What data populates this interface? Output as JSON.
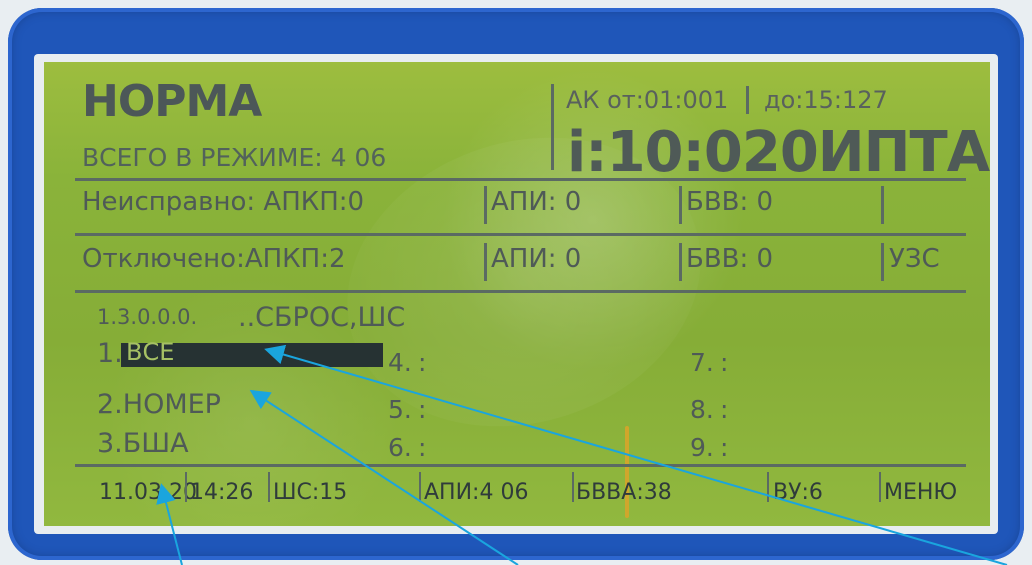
{
  "display": {
    "header": {
      "mode_big": "НОРМА",
      "mode_summary": "ВСЕГО В РЕЖИМЕ: 4 06",
      "ak_left": "АК от:01:001",
      "ak_right": "до:15:127",
      "current_big": "i:10:020ИПТА"
    },
    "rows": {
      "faulty": {
        "label": "Неисправно: АПКП:0",
        "api": "АПИ: 0",
        "bvv": "БВВ: 0"
      },
      "disabled": {
        "label": "Отключено:АПКП:2",
        "api": "АПИ: 0",
        "bvv": "БВВ: 0",
        "uzs": "УЗС"
      }
    },
    "menu": {
      "header_code": "1.3.0.0.0.",
      "header_action": "..СБРОС,ШС",
      "items": {
        "item1": "1.",
        "item1_selected": "ВСЕ",
        "item2": "2.НОМЕР",
        "item3": "3.БША",
        "slot4": "4.",
        "slot5": "5.",
        "slot6": "6.",
        "slot7": "7.",
        "slot8": "8.",
        "slot9": "9.",
        "colon": ":"
      }
    },
    "status": {
      "date": "11.03.20",
      "time": "14:26",
      "shs": "ШС:15",
      "api": "АПИ:4 06",
      "bvva": "БВВА:38",
      "vu": "ВУ:6",
      "menu": "МЕНЮ"
    }
  },
  "colors": {
    "bezel": "#1f56b9",
    "lcd_background": "#8ab33a",
    "lcd_text": "#4f5a57",
    "selection": "#263233",
    "arrow": "#1aa5de"
  }
}
